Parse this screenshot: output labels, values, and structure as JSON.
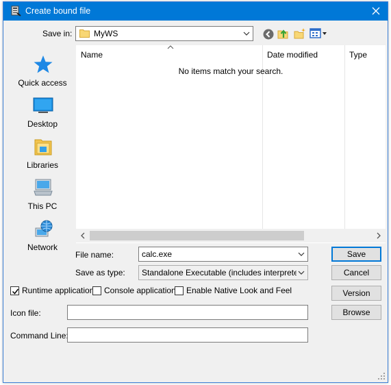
{
  "window": {
    "title": "Create bound file",
    "close_icon": "close-icon",
    "app_icon": "app-icon"
  },
  "toolbar": {
    "save_in_label": "Save in:",
    "save_in_value": "MyWS",
    "icons": [
      "back-icon",
      "up-folder-icon",
      "new-folder-icon",
      "view-menu-icon"
    ]
  },
  "places": [
    {
      "label": "Quick access",
      "icon": "quick-access-star-icon"
    },
    {
      "label": "Desktop",
      "icon": "desktop-icon"
    },
    {
      "label": "Libraries",
      "icon": "libraries-icon"
    },
    {
      "label": "This PC",
      "icon": "this-pc-icon"
    },
    {
      "label": "Network",
      "icon": "network-icon"
    }
  ],
  "file_list": {
    "columns": [
      "Name",
      "Date modified",
      "Type"
    ],
    "empty_message": "No items match your search."
  },
  "form": {
    "file_name_label": "File name:",
    "file_name_value": "calc.exe",
    "save_as_type_label": "Save as type:",
    "save_as_type_value": "Standalone Executable (includes interpreter exe",
    "save_button": "Save",
    "cancel_button": "Cancel"
  },
  "options": {
    "runtime_label": "Runtime application",
    "runtime_checked": true,
    "console_label": "Console application",
    "console_checked": false,
    "native_label": "Enable Native Look and Feel",
    "native_checked": false,
    "version_button": "Version"
  },
  "icon_file": {
    "label": "Icon file:",
    "value": "",
    "browse_button": "Browse"
  },
  "command_line": {
    "label": "Command Line:",
    "value": ""
  },
  "colors": {
    "titlebar": "#0078d7",
    "dialog_bg": "#f0f0f0",
    "button": "#e1e1e1",
    "accent_blue": "#0078d7"
  }
}
